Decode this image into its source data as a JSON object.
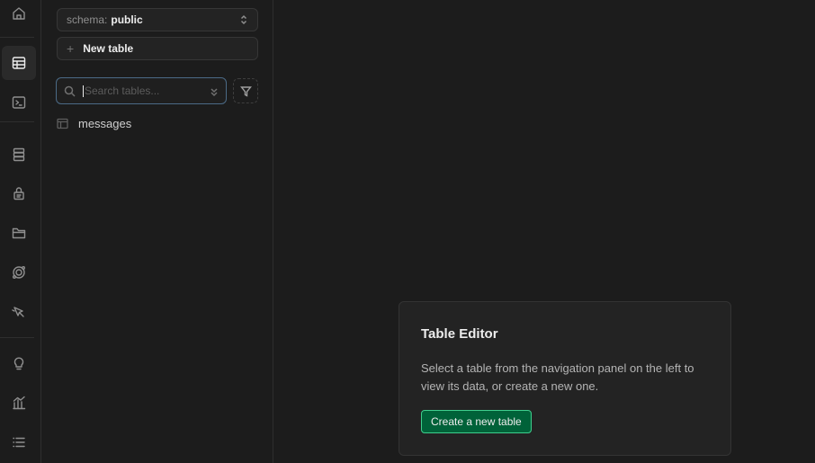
{
  "rail": {
    "icons": [
      "home-icon",
      "table-editor-icon",
      "sql-editor-icon",
      "database-icon",
      "auth-icon",
      "storage-icon",
      "edge-functions-icon",
      "realtime-icon",
      "advisors-icon",
      "reports-icon",
      "logs-icon"
    ],
    "active": "table-editor-icon"
  },
  "sidebar": {
    "schema_label": "schema:",
    "schema_value": "public",
    "new_table_label": "New table",
    "search_placeholder": "Search tables...",
    "tables": [
      {
        "name": "messages"
      }
    ]
  },
  "main": {
    "card_title": "Table Editor",
    "card_body": "Select a table from the navigation panel on the left to view its data, or create a new one.",
    "create_label": "Create a new table"
  },
  "colors": {
    "background": "#1c1c1c",
    "brand_green": "#3ecf8e",
    "button_fill": "#006239",
    "focus_ring": "#4b6a86"
  }
}
